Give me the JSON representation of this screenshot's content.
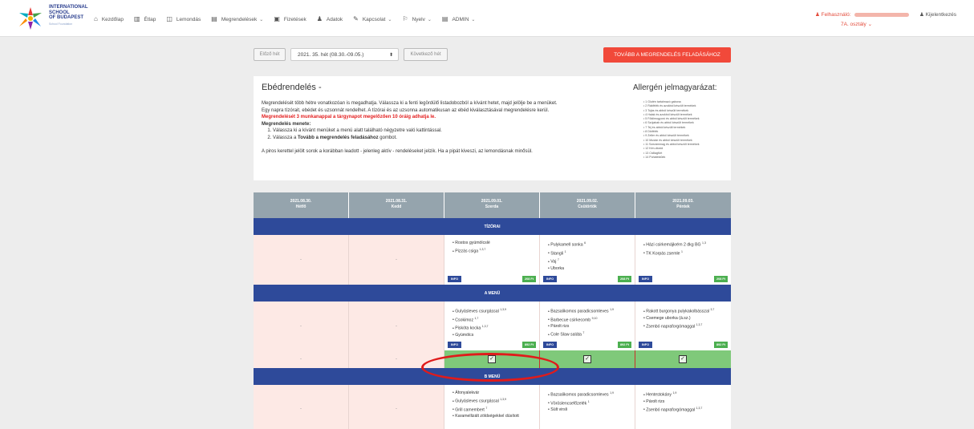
{
  "brand": {
    "line1": "INTERNATIONAL",
    "line2": "SCHOOL",
    "line3": "OF BUDAPEST",
    "tagline": "School Foundation"
  },
  "nav": [
    {
      "label": "Kezdőlap",
      "icon": "home-icon",
      "glyph": "⌂",
      "caret": false
    },
    {
      "label": "Étlap",
      "icon": "map-icon",
      "glyph": "▥",
      "caret": false
    },
    {
      "label": "Lemondás",
      "icon": "book-icon",
      "glyph": "◫",
      "caret": false
    },
    {
      "label": "Megrendelések",
      "icon": "cart-icon",
      "glyph": "▤",
      "caret": true
    },
    {
      "label": "Fizetések",
      "icon": "money-icon",
      "glyph": "▣",
      "caret": false
    },
    {
      "label": "Adatok",
      "icon": "user-icon",
      "glyph": "♟",
      "caret": false
    },
    {
      "label": "Kapcsolat",
      "icon": "edit-icon",
      "glyph": "✎",
      "caret": true
    },
    {
      "label": "Nyelv",
      "icon": "flag-icon",
      "glyph": "⚐",
      "caret": true
    },
    {
      "label": "ADMIN",
      "icon": "admin-icon",
      "glyph": "▤",
      "caret": true
    }
  ],
  "user": {
    "label": "Felhasználó:",
    "class": "7A. osztály"
  },
  "logout": "Kijelentkezés",
  "week": {
    "prev": "Előző hét",
    "next": "Következő hét",
    "selected": "2021. 35. hét (08.30.-09.05.)"
  },
  "order_button": "TOVÁBB A MEGRENDELÉS FELADÁSÁHOZ",
  "info": {
    "title": "Ebédrendelés -",
    "p1": "Megrendelését több hétre vonatkozóan is megadhatja. Válassza ki a fenti legördülő listadobozból a kívánt hetet, majd jelölje be a menüket.",
    "p2": "Egy napra tízórait, ebédet és uzsonnát rendelhet. A tízórai és az uzsonna automatikusan az ebéd kiválasztásával megrendelésre kerül.",
    "warning": "Megrendelését 3 munkanappal a tárgynapot megelőzően 10 óráig adhatja le.",
    "steps_title": "Megrendelés menete:",
    "step1": "Válassza ki a kívánt menüket a menü alatt található négyzetre való kattintással.",
    "step2_pre": "Válassza a ",
    "step2_bold": "Tovább a megrendelés feladásához",
    "step2_post": " gombot.",
    "note": "A piros kerettel jelölt sorok a korábban leadott - jelenleg aktív - rendeléseket jelzik. Ha a pipát kiveszi, az lemondásnak minősül."
  },
  "allergen": {
    "title": "Allergén jelmagyarázat:",
    "items": [
      "1 Glutén tartalmazó gabona",
      "2 Rákfélék és azokból készült termékek",
      "3 Tojás és abból készült termékek",
      "4 Halak és azokból készült termékek",
      "5 Földimogyoró és abból készült termékek",
      "6 Szójabab és abból készült termékek",
      "7 Tej és abból készült termékek",
      "8 Diófélék",
      "9 Zeller és abból készült termékek",
      "10 Mustár és abból készült termékek",
      "11 Szezámmag és abból készült termékek",
      "12 Kén-dioxid",
      "13 Csillagfürt",
      "14 Puhatestűek"
    ]
  },
  "days": [
    {
      "date": "2021.08.30.",
      "name": "Hétfő"
    },
    {
      "date": "2021.08.31.",
      "name": "Kedd"
    },
    {
      "date": "2021.09.01.",
      "name": "Szerda"
    },
    {
      "date": "2021.09.02.",
      "name": "Csütörtök"
    },
    {
      "date": "2021.09.03.",
      "name": "Péntek"
    }
  ],
  "sections": {
    "tizorai": "TÍZÓRAI",
    "a_menu": "A MENÜ",
    "b_menu": "B MENÜ"
  },
  "tags": {
    "info": "INFO",
    "tizorai_price": "208 Ft",
    "menu_price": "892 Ft"
  },
  "empty_cell": "-",
  "tizorai": [
    [],
    [],
    [
      "Rostos gyümölcslé",
      "Pizzás csiga 1,3,7"
    ],
    [
      "Pulykamell sonka 6",
      "Stangli 1",
      "Vaj 7",
      "Uborka"
    ],
    [
      "Házi csirkemájkrém 2 dkg BG 1,3",
      "TK Korpás zsemle 1"
    ]
  ],
  "a_menu": [
    [],
    [],
    [
      "Gulyásleves csurgással 1,3,9",
      "Csokimoz 1,7",
      "Piskóta kocka 1,3,7",
      "Gyümölcs"
    ],
    [
      "Bazsalikomos paradicsomleves 1,9",
      "Barbecue csirkecomb 9,10",
      "Párolt rizs",
      "Cole Slaw saláta 7"
    ],
    [
      "Rakott burgonya pulykakolbásszal 3,7",
      "Csemege uborka (á.sz.)",
      "Zsenbó napraforgómaggal 1,3,7"
    ]
  ],
  "b_menu": [
    [],
    [],
    [
      "Áfonyalekvár",
      "Gulyásleves csurgással 1,3,9",
      "Grill camembert 7",
      "Karamellizált zöldségekkel dúsított"
    ],
    [
      "Bazsalikomos paradicsomleves 1,9",
      "Vöröslencsefőzelék 1",
      "Sült virsli"
    ],
    [
      "Hentestokány 1,9",
      "Párolt rizs",
      "Zsenbó napraforgómaggal 1,3,7"
    ]
  ],
  "checks": [
    false,
    false,
    true,
    true,
    true
  ],
  "check_glyph": "✓",
  "colors": {
    "navy": "#2e4a9a",
    "accent": "#f1493a",
    "green": "#7fc97a",
    "header": "#95a4ad"
  }
}
